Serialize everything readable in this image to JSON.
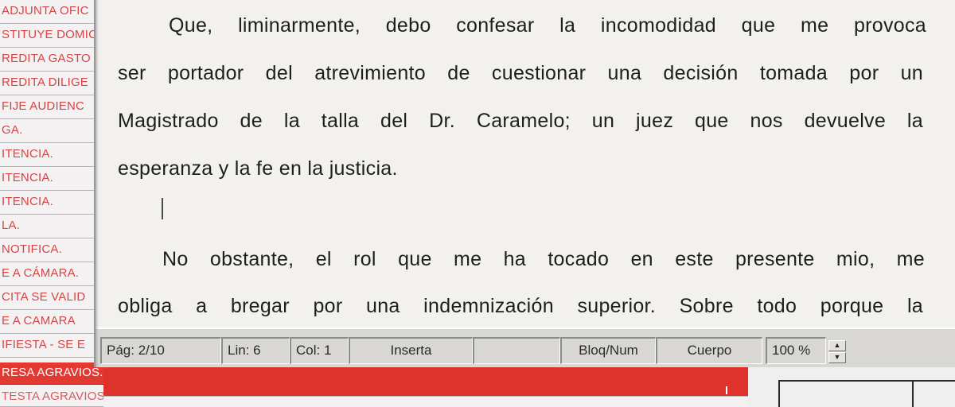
{
  "left_list": {
    "items": [
      {
        "label": "ADJUNTA OFIC"
      },
      {
        "label": "STITUYE DOMIC"
      },
      {
        "label": "REDITA GASTO"
      },
      {
        "label": "REDITA DILIGE"
      },
      {
        "label": "FIJE AUDIENC"
      },
      {
        "label": "GA."
      },
      {
        "label": "ITENCIA."
      },
      {
        "label": "ITENCIA."
      },
      {
        "label": "ITENCIA."
      },
      {
        "label": "LA."
      },
      {
        "label": "NOTIFICA."
      },
      {
        "label": "E A CÁMARA."
      },
      {
        "label": "CITA SE VALID"
      },
      {
        "label": "E A CAMARA"
      },
      {
        "label": "IFIESTA - SE E"
      },
      {
        "label": "RESA AGRAVIOS."
      },
      {
        "label": "TESTA AGRAVIOS."
      }
    ],
    "selected_index": 15
  },
  "document": {
    "lines": [
      {
        "text": "Que, liminarmente, debo confesar la incomodidad que me provoca"
      },
      {
        "text": "ser portador del atrevimiento de cuestionar una decisión tomada por un"
      },
      {
        "text": "Magistrado de la talla del Dr. Caramelo; un juez que nos devuelve la"
      },
      {
        "text": "esperanza y la fe en la justicia."
      },
      {
        "text": "No obstante, el rol que me ha tocado en este presente mio, me"
      },
      {
        "text": "obliga a bregar por una indemnización superior. Sobre todo porque la"
      }
    ]
  },
  "status_bar": {
    "page": "Pág: 2/10",
    "line": "Lin: 6",
    "column": "Col: 1",
    "mode": "Inserta",
    "numlock": "Bloq/Num",
    "style": "Cuerpo",
    "zoom": "100 %",
    "zoom_up_icon": "triangle-up",
    "zoom_down_icon": "triangle-down"
  },
  "colors": {
    "list_text": "#d64545",
    "list_selected_bg": "#e23a32",
    "document_bg": "#f2f1ee",
    "status_bg": "#d9d7d3"
  }
}
